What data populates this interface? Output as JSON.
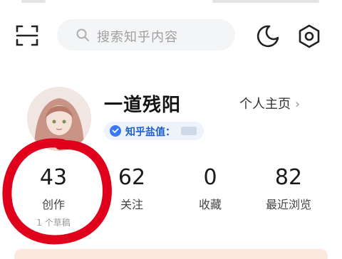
{
  "search": {
    "placeholder": "搜索知乎内容"
  },
  "icons": {
    "scan": "scan-icon",
    "search": "search-icon",
    "night_mode": "moon-icon",
    "settings": "gear-icon",
    "chevron": "chevron-right-icon",
    "shield": "shield-icon"
  },
  "profile": {
    "username": "一道残阳",
    "home_link": "个人主页",
    "badge_label": "知乎盐值："
  },
  "stats": [
    {
      "value": "43",
      "label": "创作",
      "sub": "1 个草稿"
    },
    {
      "value": "62",
      "label": "关注"
    },
    {
      "value": "0",
      "label": "收藏"
    },
    {
      "value": "82",
      "label": "最近浏览"
    }
  ],
  "colors": {
    "accent": "#1e5fcf",
    "annotation": "#e0001b",
    "search_bg": "#f4f5f7"
  }
}
